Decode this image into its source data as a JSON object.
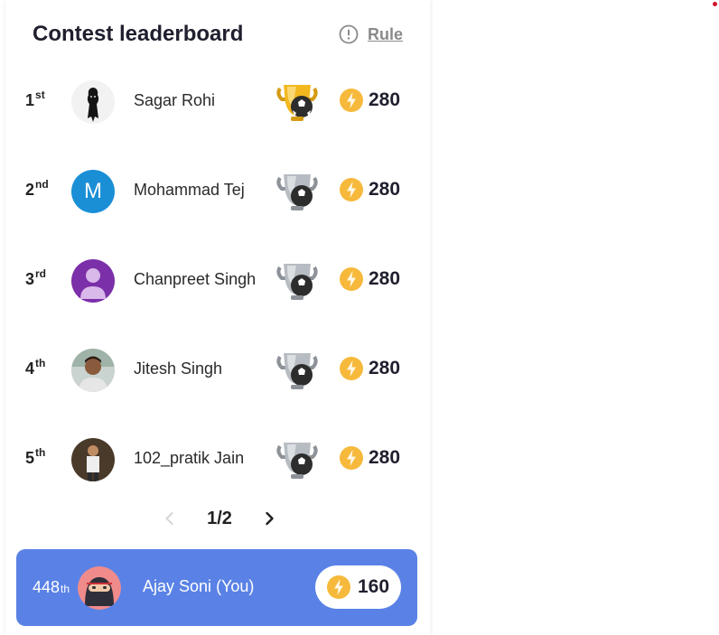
{
  "header": {
    "title": "Contest leaderboard",
    "rule_label": "Rule"
  },
  "rows": [
    {
      "rank": "1",
      "suffix": "st",
      "name": "Sagar Rohi",
      "points": "280",
      "trophy": "gold-trophy-icon",
      "avatar": "photo"
    },
    {
      "rank": "2",
      "suffix": "nd",
      "name": "Mohammad Tej",
      "points": "280",
      "trophy": "silver-trophy-icon",
      "avatar_letter": "M",
      "avatar_color": "#1a8fd6"
    },
    {
      "rank": "3",
      "suffix": "rd",
      "name": "Chanpreet Singh",
      "points": "280",
      "trophy": "silver-trophy-icon",
      "avatar_color": "#7b2fa8"
    },
    {
      "rank": "4",
      "suffix": "th",
      "name": "Jitesh Singh",
      "points": "280",
      "trophy": "silver-trophy-icon",
      "avatar": "photo"
    },
    {
      "rank": "5",
      "suffix": "th",
      "name": "102_pratik Jain",
      "points": "280",
      "trophy": "silver-trophy-icon",
      "avatar": "photo"
    }
  ],
  "pager": {
    "label": "1/2"
  },
  "you": {
    "rank": "448",
    "suffix": "th",
    "name": "Ajay Soni",
    "tag": "(You)",
    "points": "160",
    "color": "#5a82e6"
  },
  "colors": {
    "bolt": "#f6b93b",
    "gold": "#f2b81e",
    "silver": "#9aa0a6"
  }
}
